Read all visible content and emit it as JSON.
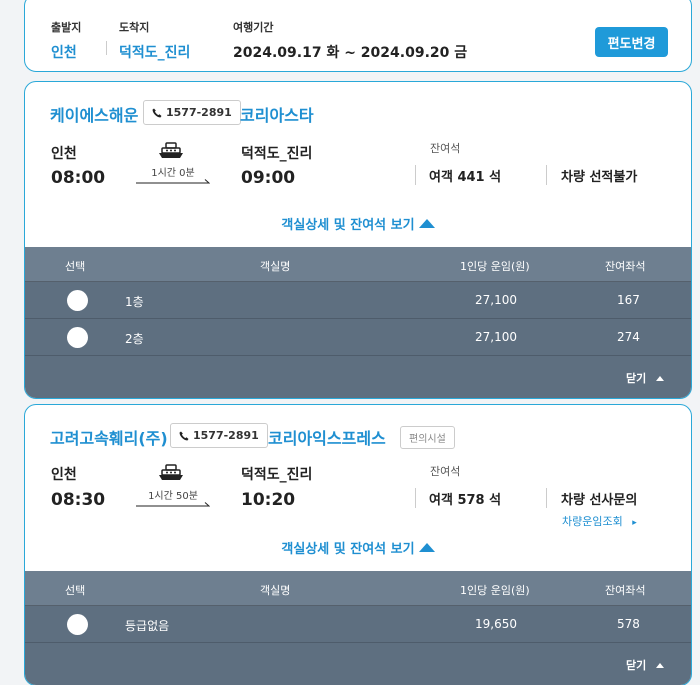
{
  "summary": {
    "departure_label": "출발지",
    "departure_value": "인천",
    "arrival_label": "도착지",
    "arrival_value": "덕적도_진리",
    "period_label": "여행기간",
    "period_value": "2024.09.17 화 ~ 2024.09.20 금",
    "change_button": "편도변경"
  },
  "sailings": [
    {
      "company": "케이에스해운",
      "phone": "1577-2891",
      "vessel": "코리아스타",
      "from_port": "인천",
      "from_time": "08:00",
      "duration": "1시간 0분",
      "to_port": "덕적도_진리",
      "to_time": "09:00",
      "seat_label": "잔여석",
      "seat_count": "여객 441 석",
      "car_status": "차량 선적불가",
      "detail_toggle": "객실상세 및 잔여석 보기",
      "table_headers": [
        "선택",
        "객실명",
        "1인당 운임(원)",
        "잔여좌석"
      ],
      "rows": [
        {
          "name": "1층",
          "fare": "27,100",
          "seats": "167"
        },
        {
          "name": "2층",
          "fare": "27,100",
          "seats": "274"
        }
      ],
      "close_label": "닫기"
    },
    {
      "company": "고려고속훼리(주)",
      "phone": "1577-2891",
      "vessel": "코리아익스프레스",
      "facility": "편의시설",
      "from_port": "인천",
      "from_time": "08:30",
      "duration": "1시간 50분",
      "to_port": "덕적도_진리",
      "to_time": "10:20",
      "seat_label": "잔여석",
      "seat_count": "여객 578 석",
      "car_status": "차량 선사문의",
      "car_link": "차량운임조회",
      "detail_toggle": "객실상세 및 잔여석 보기",
      "table_headers": [
        "선택",
        "객실명",
        "1인당 운임(원)",
        "잔여좌석"
      ],
      "rows": [
        {
          "name": "등급없음",
          "fare": "19,650",
          "seats": "578"
        }
      ],
      "close_label": "닫기"
    }
  ],
  "icons": {
    "phone": "phone-icon",
    "ship": "ship-icon",
    "arrow": "arrow-right-icon",
    "toggle": "triangle-up-icon",
    "chevron": "chevron-right-icon"
  },
  "colors": {
    "accent": "#1f8fd1",
    "border": "#2aa8d8",
    "table_bg": "#5e6f80",
    "table_head": "#6e7f90"
  }
}
